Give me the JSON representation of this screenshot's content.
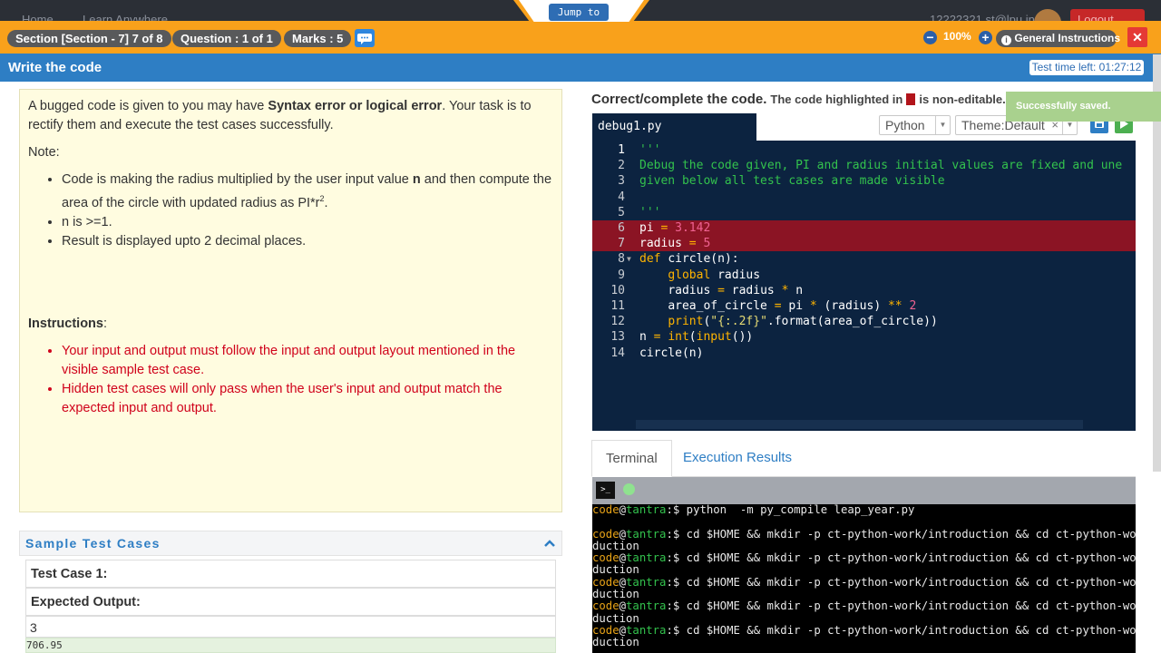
{
  "topnav": {
    "home": "Home",
    "learn": "Learn Anywhere",
    "user": "12222321.st@lpu.in",
    "logout": "Logout"
  },
  "jump_to": "Jump to",
  "header": {
    "section": "Section [Section - 7] 7 of 8",
    "question": "Question : 1 of 1",
    "marks": "Marks : 5",
    "zoom": "100%",
    "general_instructions": "General Instructions",
    "close": "✕",
    "chat_icon": "chat-icon"
  },
  "titlebar": {
    "title": "Write the code",
    "timer": "Test time left: 01:27:12"
  },
  "problem": {
    "intro_pre": "A bugged code is given to you may have ",
    "intro_bold": "Syntax error or logical error",
    "intro_post": ". Your task is to rectify them and execute the test cases successfully.",
    "note_label": "Note",
    "note_1_pre": "Code is making the radius multiplied by the user input value ",
    "note_1_bold": "n",
    "note_1_post": " and then compute the area of the circle with updated radius as PI*r",
    "note_1_sup": "2",
    "note_1_end": ".",
    "note_2": "n is >=1.",
    "note_3": "Result is displayed upto 2 decimal places.",
    "instructions_label": "Instructions",
    "instr_1": "Your input and output must follow the input and output layout mentioned in the visible sample test case.",
    "instr_2": "Hidden test cases will only pass when the user's input and output match the expected input and output."
  },
  "sample": {
    "heading": "Sample Test Cases",
    "test_case_label": "Test Case 1:",
    "expected_label": "Expected Output:",
    "input": "3",
    "output": "706.95"
  },
  "editor": {
    "heading": "Correct/complete the code.",
    "heading_sub_pre": "The code highlighted in",
    "heading_sub_post": "is non-editable.",
    "toast": "Successfully saved.",
    "filename": "debug1.py",
    "language": "Python",
    "theme": "Theme:Default",
    "lines": [
      "'''",
      "Debug the code given, PI and radius initial values are fixed and une",
      "given below all test cases are made visible",
      "",
      "'''",
      "pi = 3.142",
      "radius = 5",
      "def circle(n):",
      "    global radius",
      "    radius = radius * n",
      "    area_of_circle = pi * (radius) ** 2",
      "    print(\"{:.2f}\".format(area_of_circle))",
      "n = int(input())",
      "circle(n)"
    ]
  },
  "panel_tabs": {
    "terminal": "Terminal",
    "results": "Execution Results"
  },
  "terminal": {
    "user": "code",
    "host": "tantra",
    "prompt_end": ":$",
    "commands": [
      " python  -m py_compile leap_year.py",
      " cd $HOME && mkdir -p ct-python-work/introduction && cd ct-python-work/intro",
      " cd $HOME && mkdir -p ct-python-work/introduction && cd ct-python-work/intro",
      " cd $HOME && mkdir -p ct-python-work/introduction && cd ct-python-work/intro",
      " cd $HOME && mkdir -p ct-python-work/introduction && cd ct-python-work/intro",
      " cd $HOME && mkdir -p ct-python-work/introduction && cd ct-python-work/intro"
    ],
    "wrap": "duction"
  },
  "colors": {
    "accent_orange": "#f9a11b",
    "accent_blue": "#2e7ec4",
    "editor_bg": "#0c2340",
    "readonly_red": "#8b1424"
  }
}
